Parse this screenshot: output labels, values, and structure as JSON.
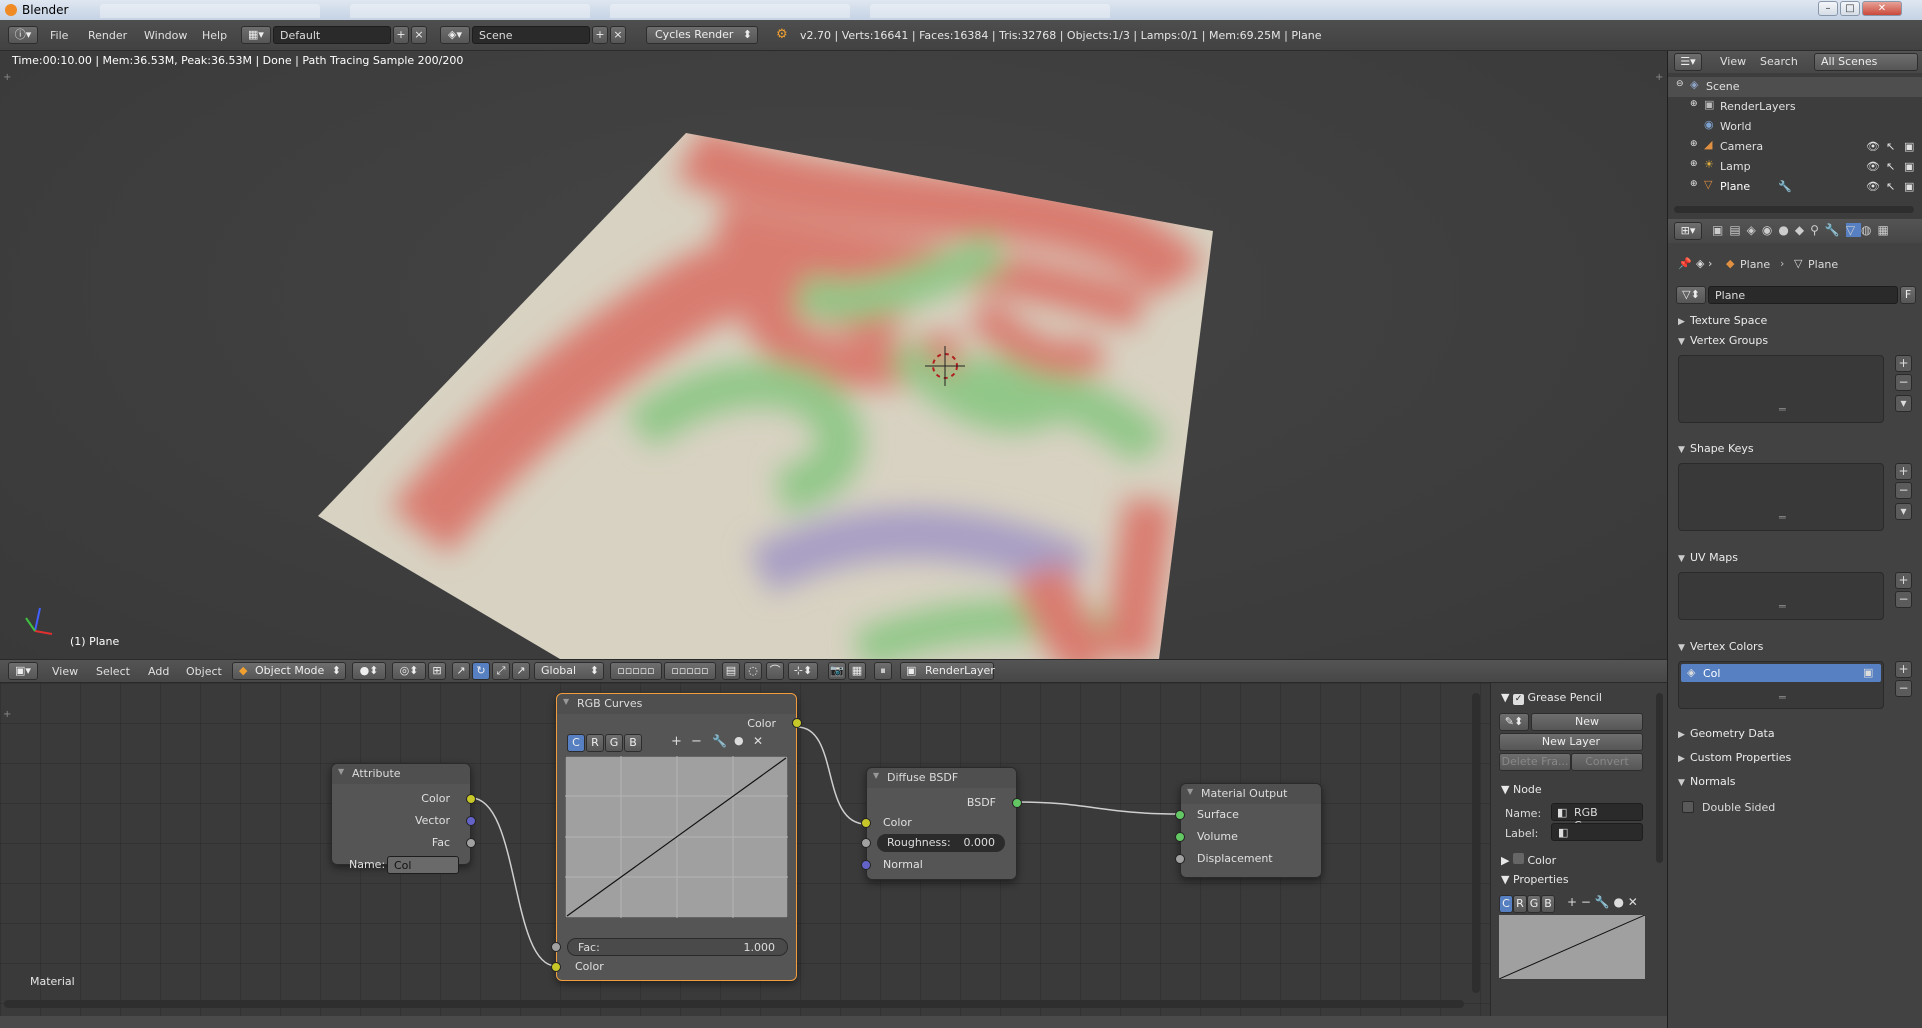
{
  "window": {
    "title": "Blender",
    "controls": [
      "–",
      "□",
      "✕"
    ]
  },
  "topbar": {
    "menus": [
      "File",
      "Render",
      "Window",
      "Help"
    ],
    "layout": "Default",
    "scene": "Scene",
    "engine": "Cycles Render",
    "stats": "v2.70 | Verts:16641 | Faces:16384 | Tris:32768 | Objects:1/3 | Lamps:0/1 | Mem:69.25M | Plane"
  },
  "viewport": {
    "info": "Time:00:10.00 | Mem:36.53M, Peak:36.53M | Done | Path Tracing Sample 200/200",
    "object_label": "(1) Plane"
  },
  "viewport_header": {
    "menus": [
      "View",
      "Select",
      "Add",
      "Object"
    ],
    "mode": "Object Mode",
    "orientation": "Global",
    "render_layer": "RenderLayer"
  },
  "node_editor": {
    "material_label": "Material",
    "attribute": {
      "title": "Attribute",
      "outputs": [
        "Color",
        "Vector",
        "Fac"
      ],
      "name_label": "Name:",
      "name_value": "Col"
    },
    "rgb_curves": {
      "title": "RGB Curves",
      "output": "Color",
      "channels": [
        "C",
        "R",
        "G",
        "B"
      ],
      "fac_label": "Fac:",
      "fac_value": "1.000",
      "input": "Color"
    },
    "diffuse": {
      "title": "Diffuse BSDF",
      "output": "BSDF",
      "inputs": [
        "Color",
        "Normal"
      ],
      "roughness_label": "Roughness:",
      "roughness_value": "0.000"
    },
    "output": {
      "title": "Material Output",
      "inputs": [
        "Surface",
        "Volume",
        "Displacement"
      ]
    }
  },
  "node_side": {
    "grease_pencil": "Grease Pencil",
    "new": "New",
    "new_layer": "New Layer",
    "delete_frame": "Delete Fra...",
    "convert": "Convert",
    "node_header": "Node",
    "name_label": "Name:",
    "name_value": "RGB Curves",
    "label_label": "Label:",
    "color_header": "Color",
    "properties_header": "Properties",
    "channels": [
      "C",
      "R",
      "G",
      "B"
    ]
  },
  "outliner": {
    "menus": [
      "View",
      "Search"
    ],
    "filter": "All Scenes",
    "items": [
      "Scene",
      "RenderLayers",
      "World",
      "Camera",
      "Lamp",
      "Plane"
    ]
  },
  "properties": {
    "breadcrumb": [
      "Plane",
      "Plane"
    ],
    "mesh_name": "Plane",
    "mesh_fake": "F",
    "sections": {
      "texture_space": "Texture Space",
      "vertex_groups": "Vertex Groups",
      "shape_keys": "Shape Keys",
      "uv_maps": "UV Maps",
      "vertex_colors": "Vertex Colors",
      "geometry_data": "Geometry Data",
      "custom_properties": "Custom Properties",
      "normals": "Normals"
    },
    "vertex_color_item": "Col",
    "double_sided": "Double Sided"
  },
  "colors": {
    "accent": "#5680c2",
    "node_selected": "#f29d3d",
    "socket_yellow": "#c7c729",
    "socket_green": "#63c763"
  }
}
